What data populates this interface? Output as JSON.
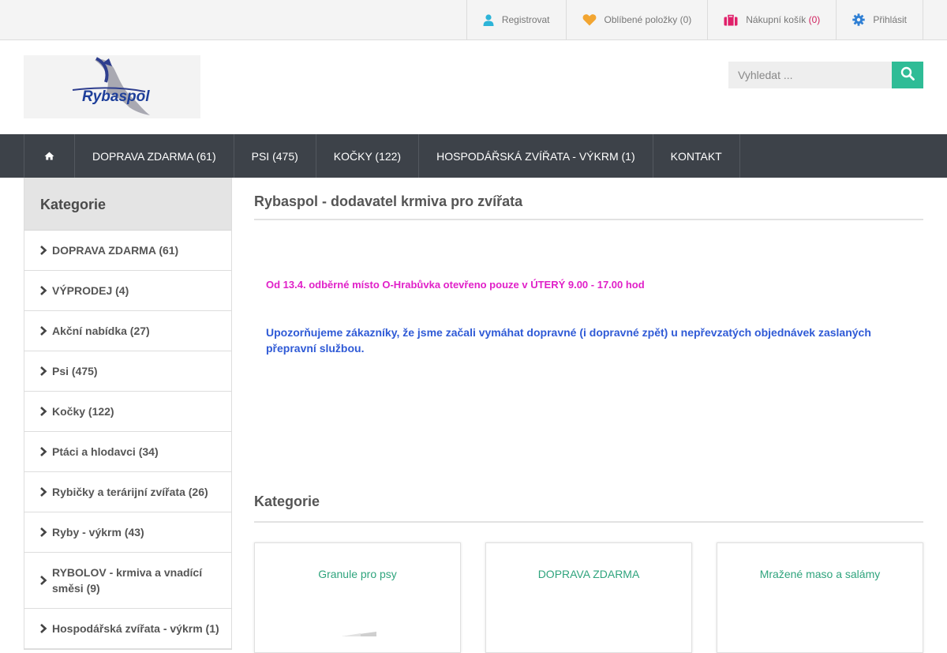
{
  "topbar": {
    "register": "Registrovat",
    "favorites": "Oblíbené položky (0)",
    "cart_label": "Nákupní košík",
    "cart_count": "(0)",
    "login": "Přihlásit"
  },
  "header": {
    "logo_text": "Rybaspol",
    "search_placeholder": "Vyhledat ..."
  },
  "nav": {
    "items": [
      {
        "label": "DOPRAVA ZDARMA (61)"
      },
      {
        "label": "PSI (475)"
      },
      {
        "label": "KOČKY (122)"
      },
      {
        "label": "HOSPODÁŘSKÁ ZVÍŘATA - VÝKRM (1)"
      },
      {
        "label": "KONTAKT"
      }
    ]
  },
  "sidebar": {
    "title": "Kategorie",
    "items": [
      {
        "label": "DOPRAVA ZDARMA (61)"
      },
      {
        "label": "VÝPRODEJ (4)"
      },
      {
        "label": "Akční nabídka (27)"
      },
      {
        "label": "Psi (475)"
      },
      {
        "label": "Kočky (122)"
      },
      {
        "label": "Ptáci a hlodavci (34)"
      },
      {
        "label": "Rybičky a terárijní zvířata (26)"
      },
      {
        "label": "Ryby - výkrm (43)"
      },
      {
        "label": "RYBOLOV - krmiva a vnadící směsi (9)"
      },
      {
        "label": "Hospodářská zvířata - výkrm (1)"
      }
    ]
  },
  "main": {
    "title": "Rybaspol - dodavatel krmiva pro zvířata",
    "notice_hours": "Od 13.4. odběrné místo O-Hrabůvka otevřeno pouze v ÚTERÝ 9.00 - 17.00 hod",
    "notice_shipping": "Upozorňujeme zákazníky, že jsme začali vymáhat dopravné (i dopravné zpět) u nepřevzatých objednávek zaslaných přepravní službou.",
    "categories_title": "Kategorie",
    "cards": [
      {
        "label": "Granule pro psy"
      },
      {
        "label": "DOPRAVA ZDARMA"
      },
      {
        "label": "Mražené maso a salámy"
      }
    ]
  },
  "colors": {
    "accent": "#2fbc96",
    "nav_bg": "#3d4249",
    "notice_pink": "#e020c8",
    "notice_blue": "#2f5ad6"
  }
}
